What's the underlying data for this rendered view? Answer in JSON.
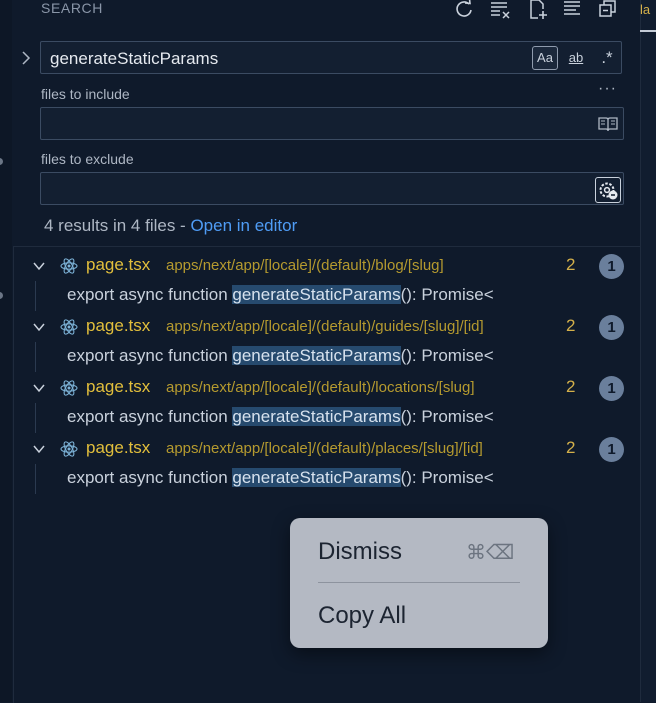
{
  "header": {
    "title": "SEARCH",
    "actions": [
      "refresh-icon",
      "clear-results-icon",
      "new-search-editor-icon",
      "view-as-tree-icon",
      "collapse-all-icon"
    ]
  },
  "right_tab": {
    "partial_label": "la"
  },
  "search": {
    "query": "generateStaticParams",
    "options": {
      "match_case": "Aa",
      "whole_word": "ab",
      "regex": ".*"
    }
  },
  "include": {
    "label": "files to include",
    "value": ""
  },
  "exclude": {
    "label": "files to exclude",
    "value": ""
  },
  "summary": {
    "text": "4 results in 4 files - ",
    "link": "Open in editor"
  },
  "results": [
    {
      "file": "page.tsx",
      "path": "apps/next/app/[locale]/(default)/blog/[slug]",
      "count": "2",
      "badge": "1",
      "match": {
        "before": "export async function ",
        "highlight": "generateStaticParams",
        "after": "(): Promise<"
      }
    },
    {
      "file": "page.tsx",
      "path": "apps/next/app/[locale]/(default)/guides/[slug]/[id]",
      "count": "2",
      "badge": "1",
      "match": {
        "before": "export async function ",
        "highlight": "generateStaticParams",
        "after": "(): Promise<"
      }
    },
    {
      "file": "page.tsx",
      "path": "apps/next/app/[locale]/(default)/locations/[slug]",
      "count": "2",
      "badge": "1",
      "match": {
        "before": "export async function ",
        "highlight": "generateStaticParams",
        "after": "(): Promise<"
      }
    },
    {
      "file": "page.tsx",
      "path": "apps/next/app/[locale]/(default)/places/[slug]/[id]",
      "count": "2",
      "badge": "1",
      "match": {
        "before": "export async function ",
        "highlight": "generateStaticParams",
        "after": "(): Promise<"
      }
    }
  ],
  "context_menu": {
    "dismiss": "Dismiss",
    "dismiss_shortcut": "⌘⌫",
    "copy_all": "Copy All"
  },
  "colors": {
    "background": "#0f1a2b",
    "filename": "#e2bf3c",
    "link": "#4f9cf5",
    "match_highlight": "#264a6e",
    "badge": "#6a7f9c",
    "menu": "#b4b9c3"
  }
}
